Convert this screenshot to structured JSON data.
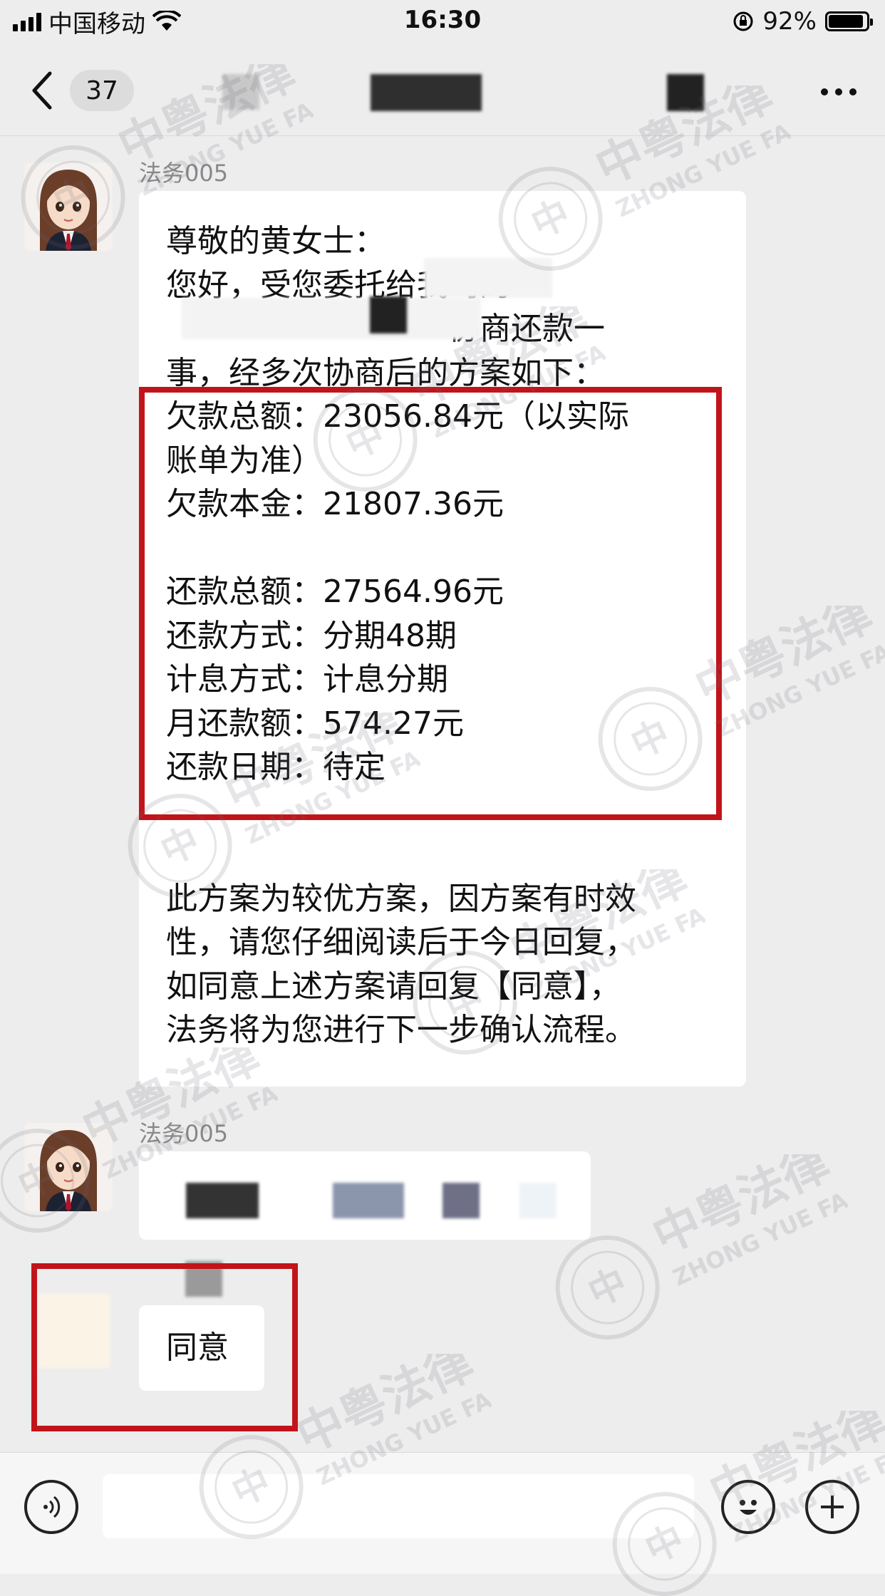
{
  "status_bar": {
    "carrier": "中国移动",
    "time": "16:30",
    "battery_percent": "92%",
    "battery_level": 0.92
  },
  "nav": {
    "unread_count": "37"
  },
  "messages": [
    {
      "sender": "法务005",
      "lines": [
        "尊敬的黄女士：",
        "您好，受您委托给我司的",
        "　　　　　　　　　协商还款一",
        "事，经多次协商后的方案如下：",
        "欠款总额：23056.84元（以实际",
        "账单为准）",
        "欠款本金：21807.36元",
        "",
        "还款总额：27564.96元",
        "还款方式：分期48期",
        "计息方式：计息分期",
        "月还款额：574.27元",
        "还款日期：待定",
        "",
        "",
        "此方案为较优方案，因方案有时效",
        "性，请您仔细阅读后于今日回复，",
        "如同意上述方案请回复【同意】，",
        "法务将为您进行下一步确认流程。"
      ]
    },
    {
      "sender": "法务005"
    },
    {
      "reply": "同意"
    }
  ],
  "watermark": {
    "cn": "中粤法律",
    "en": "ZHONG YUE FA LV",
    "seal": "中"
  },
  "icons": {
    "back": "chevron-left-icon",
    "more": "more-dots-icon",
    "voice": "voice-icon",
    "emoji": "emoji-icon",
    "plus": "plus-icon"
  },
  "colors": {
    "highlight_box": "#c1141a",
    "background": "#ededed",
    "bubble": "#ffffff"
  }
}
